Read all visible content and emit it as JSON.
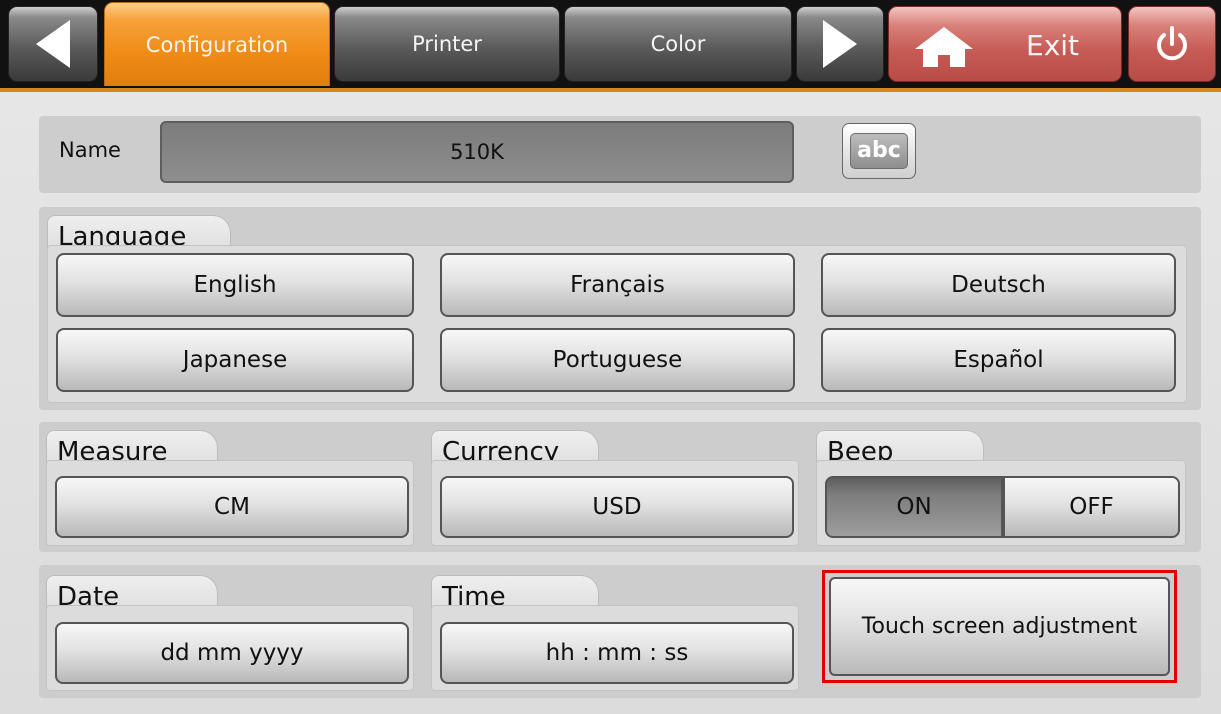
{
  "tabs": {
    "configuration": "Configuration",
    "printer": "Printer",
    "color": "Color",
    "exit": "Exit"
  },
  "name_section": {
    "label": "Name",
    "value": "510K",
    "keyboard_button": "abc"
  },
  "language": {
    "title": "Language",
    "options": [
      "English",
      "Français",
      "Deutsch",
      "Japanese",
      "Portuguese",
      "Español"
    ]
  },
  "measure": {
    "title": "Measure",
    "value": "CM"
  },
  "currency": {
    "title": "Currency",
    "value": "USD"
  },
  "beep": {
    "title": "Beep",
    "on_label": "ON",
    "off_label": "OFF",
    "selected": "ON"
  },
  "date": {
    "title": "Date",
    "format": "dd mm yyyy"
  },
  "time": {
    "title": "Time",
    "format": "hh : mm : ss"
  },
  "touch_screen": {
    "label": "Touch screen adjustment"
  },
  "colors": {
    "accent_tab": "#f08c16",
    "exit_red": "#c65a54",
    "highlight_border": "#e50000"
  }
}
